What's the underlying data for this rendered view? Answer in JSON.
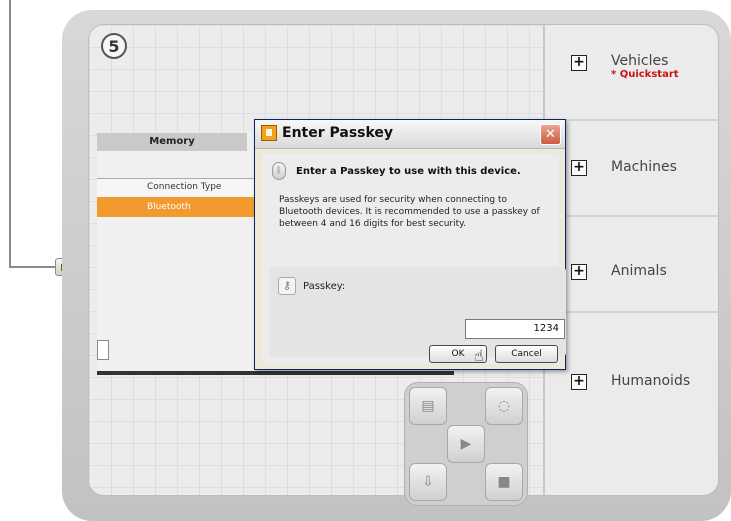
{
  "step_number": "5",
  "background_window": {
    "tab_label": "Memory",
    "column_header": "Connection Type",
    "selected_row_value": "Bluetooth"
  },
  "dialog": {
    "title": "Enter Passkey",
    "close_label": "✕",
    "heading": "Enter a Passkey to use with this device.",
    "description": "Passkeys are used for security when connecting to Bluetooth devices. It is recommended to use a passkey of between 4 and 16 digits for best security.",
    "passkey_label": "Passkey:",
    "passkey_value": "1234",
    "ok_label": "OK",
    "cancel_label": "Cancel"
  },
  "categories": [
    {
      "label": "Vehicles",
      "badge": "* Quickstart"
    },
    {
      "label": "Machines"
    },
    {
      "label": "Animals"
    },
    {
      "label": "Humanoids"
    }
  ],
  "colors": {
    "selection": "#f29a2e",
    "quickstart": "#cc1111",
    "dialog_bg": "#ece9d8"
  }
}
